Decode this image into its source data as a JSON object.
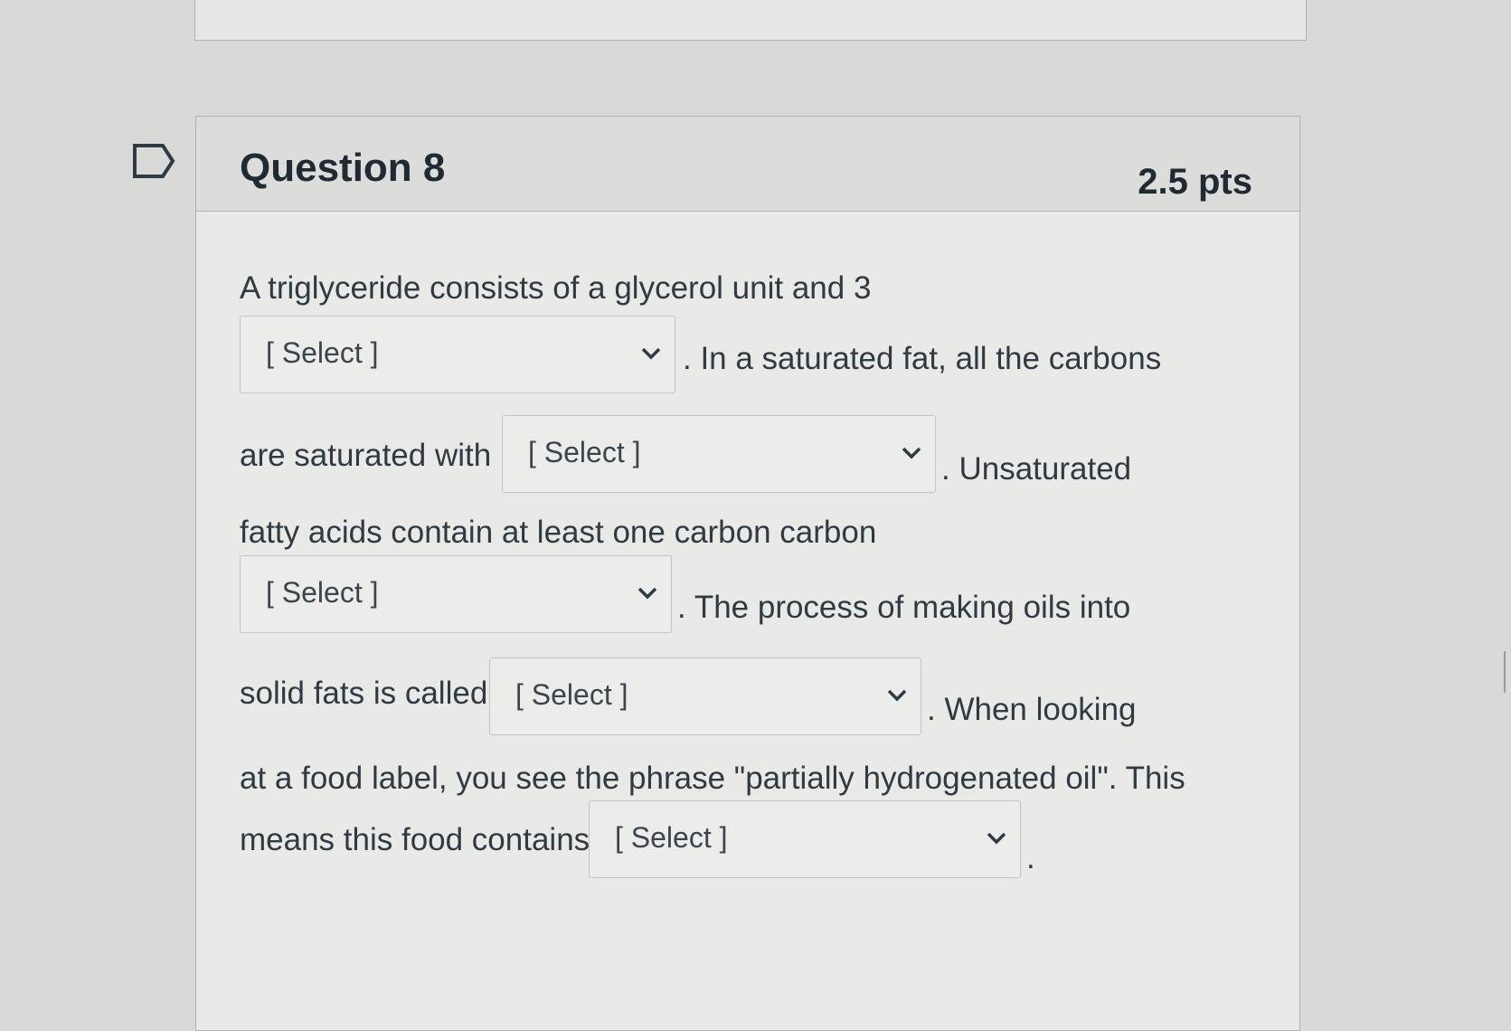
{
  "question": {
    "title": "Question 8",
    "points": "2.5 pts"
  },
  "body": {
    "line1": "A triglyceride consists of a glycerol unit and 3",
    "after1": ". In a saturated fat, all the carbons",
    "line2": "are saturated with",
    "after2": ". Unsaturated",
    "line3": "fatty acids contain at least one carbon carbon",
    "after3": ". The process of making oils into",
    "line4": "solid fats is called",
    "after4": ". When looking",
    "line5": "at a food label, you see the phrase \"partially hydrogenated oil\". This",
    "line6": "means this food contains",
    "after6": "."
  },
  "selects": [
    {
      "value": "[ Select ]"
    },
    {
      "value": "[ Select ]"
    },
    {
      "value": "[ Select ]"
    },
    {
      "value": "[ Select ]"
    },
    {
      "value": "[ Select ]"
    }
  ],
  "icons": {
    "flag": "flag-outline-icon",
    "chevron": "chevron-down-icon"
  },
  "colors": {
    "background": "#d9d9d7",
    "header": "#dcdcda",
    "text": "#2f3a42"
  }
}
